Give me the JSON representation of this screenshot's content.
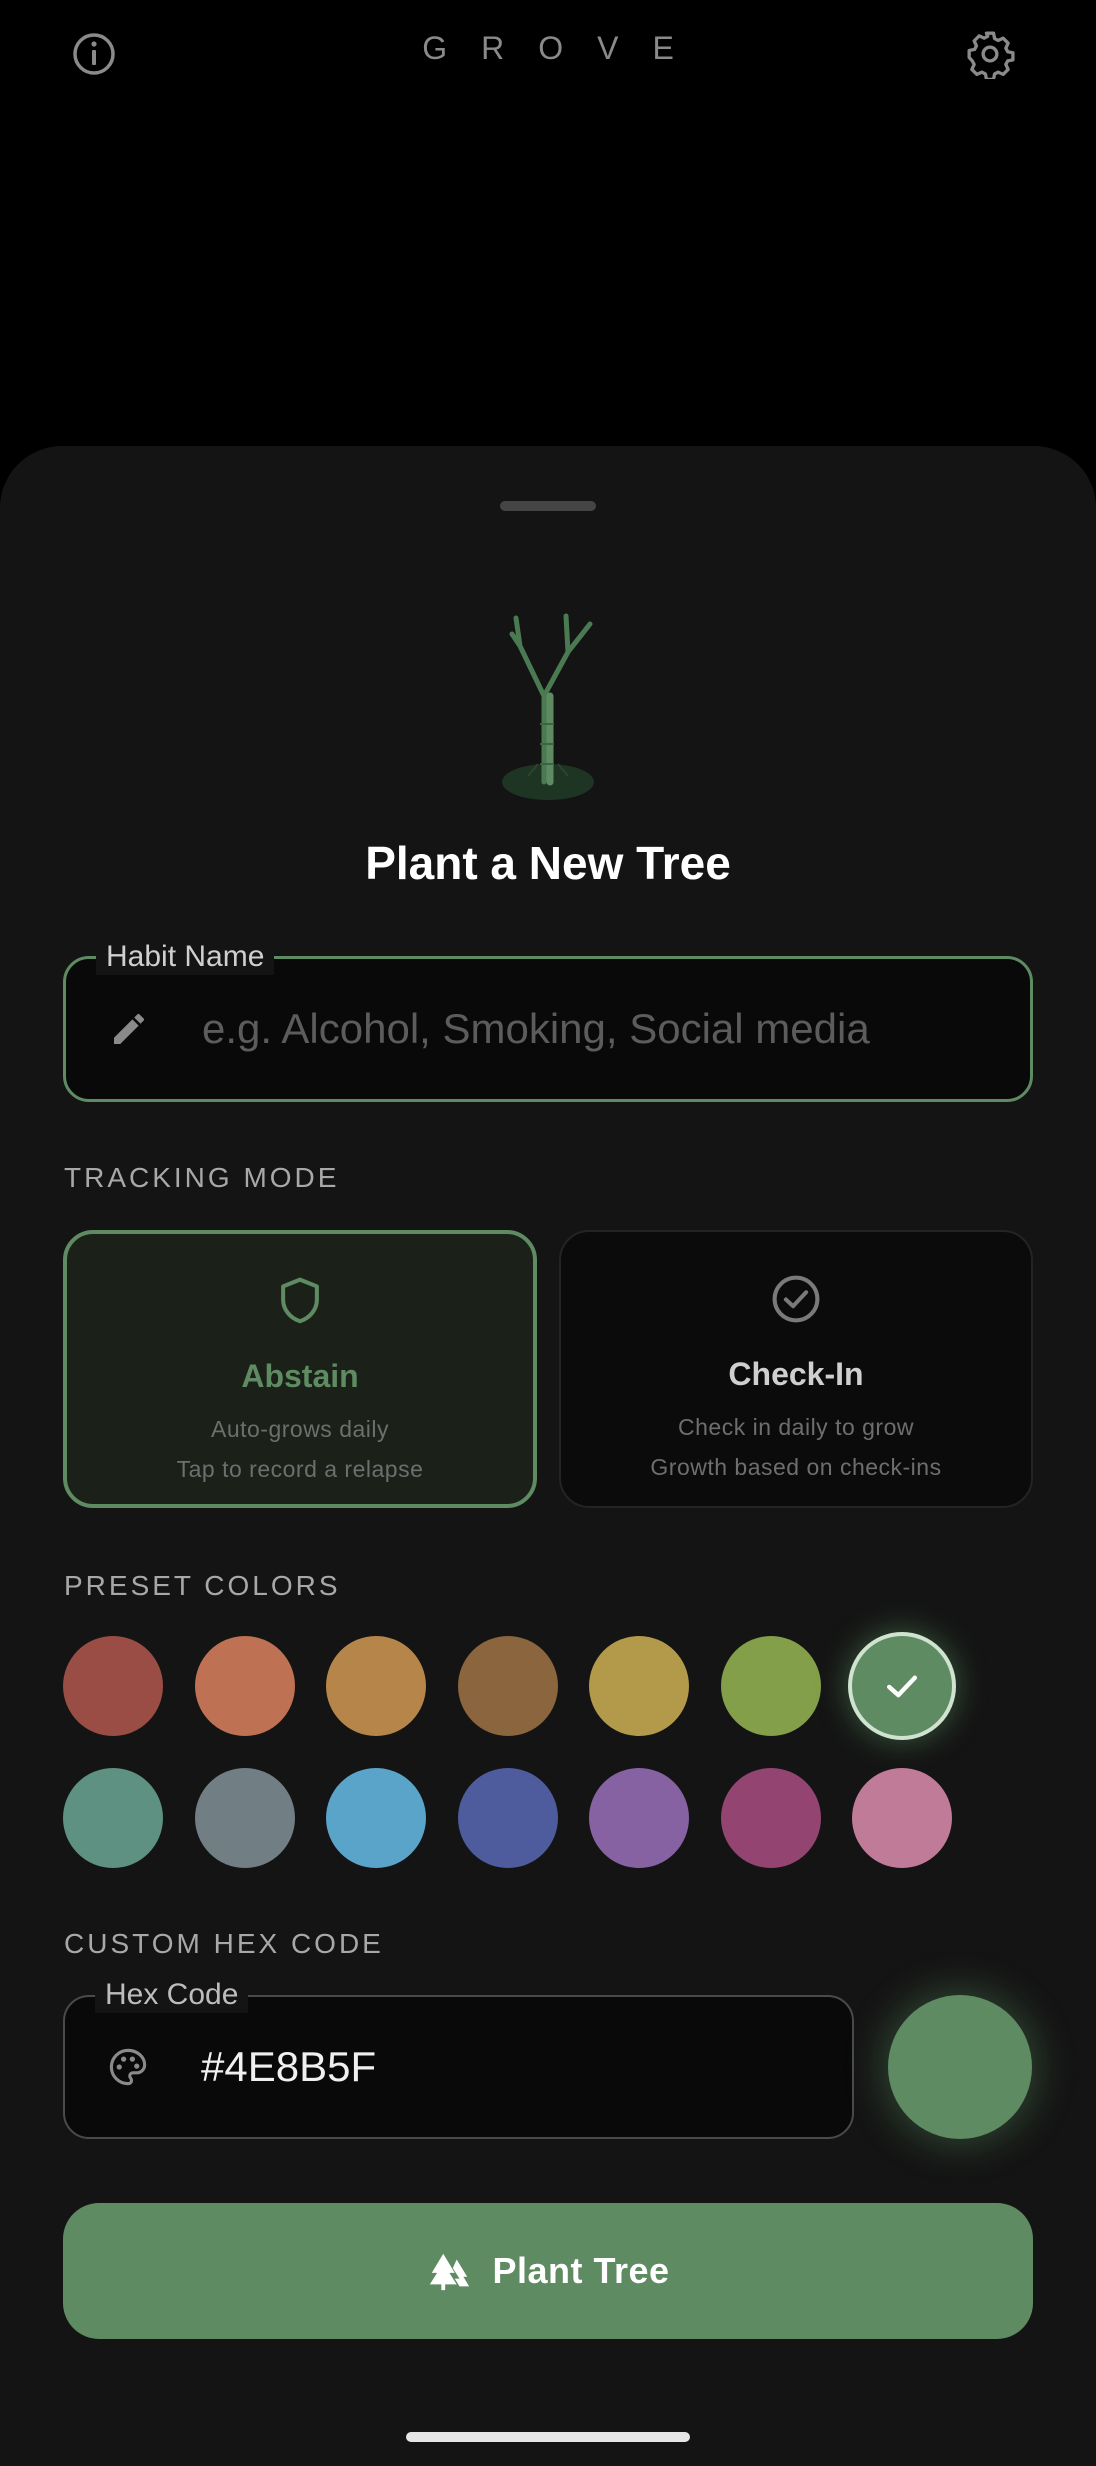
{
  "app": {
    "brand": "GROVE"
  },
  "sheet": {
    "title": "Plant a New Tree",
    "habit_field": {
      "label": "Habit Name",
      "placeholder": "e.g. Alcohol, Smoking, Social media",
      "value": ""
    },
    "tracking_mode": {
      "section_label": "TRACKING MODE",
      "options": [
        {
          "title": "Abstain",
          "line1": "Auto-grows daily",
          "line2": "Tap to record a relapse",
          "icon": "shield-icon",
          "selected": true
        },
        {
          "title": "Check-In",
          "line1": "Check in daily to grow",
          "line2": "Growth based on check-ins",
          "icon": "check-circle-icon",
          "selected": false
        }
      ]
    },
    "preset_colors": {
      "section_label": "PRESET COLORS",
      "colors": [
        "#9A4D44",
        "#BF7253",
        "#B5854A",
        "#8A653E",
        "#B39A4A",
        "#839F49",
        "#5E8B62",
        "#5E9181",
        "#717E84",
        "#5AA3C9",
        "#4E5C9D",
        "#8762A2",
        "#934471",
        "#BF7B98"
      ],
      "selected_index": 6
    },
    "custom_hex": {
      "section_label": "CUSTOM HEX CODE",
      "label": "Hex Code",
      "value": "#4E8B5F",
      "preview_color": "#5E8B62"
    },
    "submit": {
      "label": "Plant Tree",
      "icon": "trees-icon"
    }
  },
  "theme": {
    "accent": "#5E8B62",
    "background": "#000000",
    "sheet": "#141414"
  }
}
